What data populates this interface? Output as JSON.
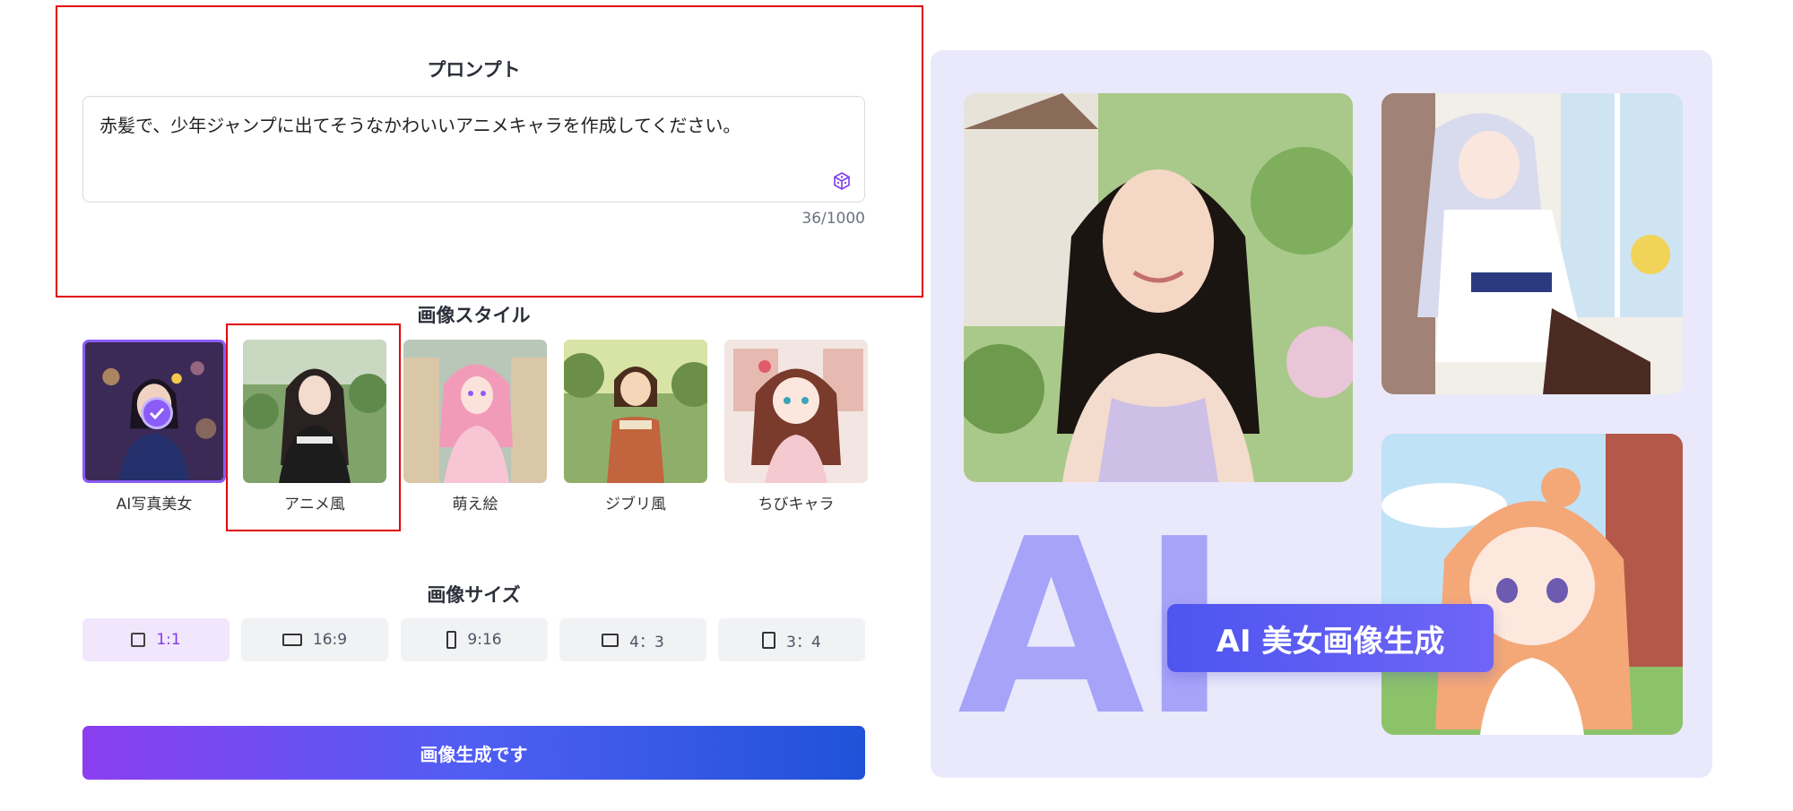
{
  "prompt": {
    "title": "プロンプト",
    "text": "赤髪で、少年ジャンプに出てそうなかわいいアニメキャラを作成してください。",
    "counter": "36/1000"
  },
  "style": {
    "title": "画像スタイル",
    "items": [
      {
        "label": "AI写真美女",
        "selected": true
      },
      {
        "label": "アニメ風",
        "selected": false
      },
      {
        "label": "萌え絵",
        "selected": false
      },
      {
        "label": "ジブリ風",
        "selected": false
      },
      {
        "label": "ちびキャラ",
        "selected": false
      }
    ]
  },
  "size": {
    "title": "画像サイズ",
    "options": [
      {
        "label": "1:1",
        "active": true
      },
      {
        "label": "16:9",
        "active": false
      },
      {
        "label": "9:16",
        "active": false
      },
      {
        "label": "4：3",
        "active": false
      },
      {
        "label": "3：4",
        "active": false
      }
    ]
  },
  "generate_label": "画像生成です",
  "banner": {
    "big_text": "AI",
    "pill_text": "AI 美女画像生成"
  },
  "colors": {
    "accent": "#8b5cf6",
    "highlight": "#e00000",
    "banner_bg": "#e9e9fb"
  }
}
